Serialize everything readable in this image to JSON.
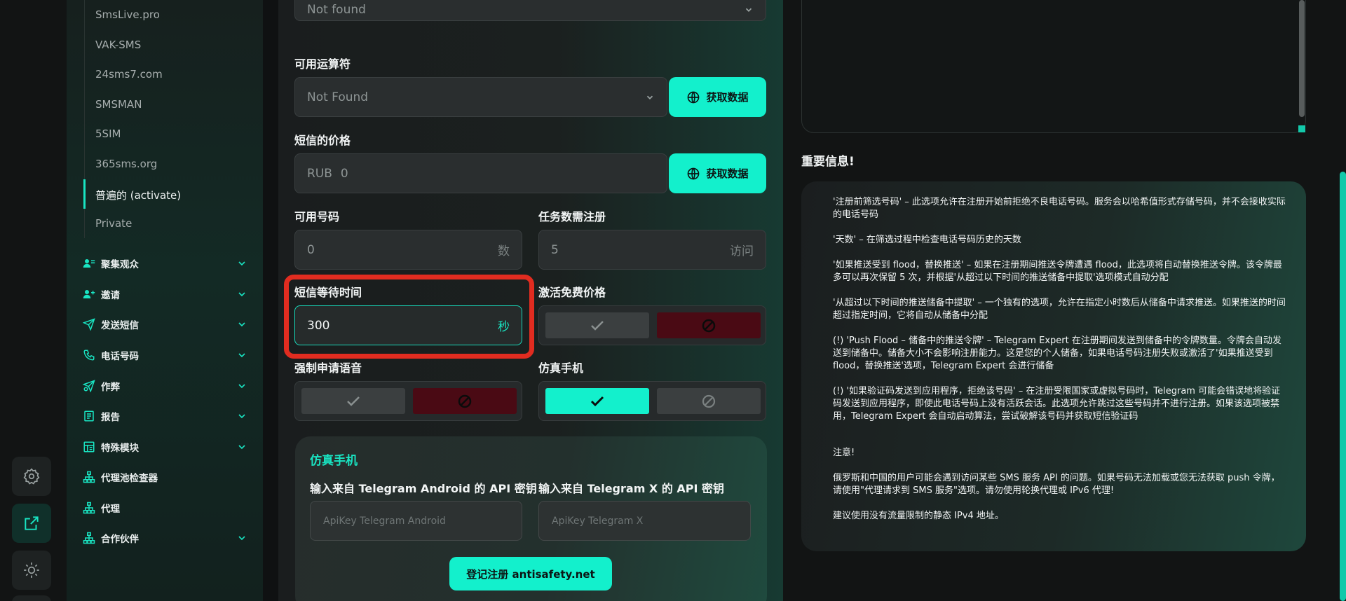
{
  "sidebar": {
    "sub_items": [
      {
        "label": "SmsLive.pro",
        "active": false
      },
      {
        "label": "VAK-SMS",
        "active": false
      },
      {
        "label": "24sms7.com",
        "active": false
      },
      {
        "label": "SMSMAN",
        "active": false
      },
      {
        "label": "5SIM",
        "active": false
      },
      {
        "label": "365sms.org",
        "active": false
      },
      {
        "label": "普遍的 (activate)",
        "active": true
      },
      {
        "label": "Private",
        "active": false
      }
    ],
    "menu": [
      {
        "label": "聚集观众",
        "icon": "users-icon",
        "has_chevron": true
      },
      {
        "label": "邀请",
        "icon": "user-plus-icon",
        "has_chevron": true
      },
      {
        "label": "发送短信",
        "icon": "send-icon",
        "has_chevron": true
      },
      {
        "label": "电话号码",
        "icon": "phone-icon",
        "has_chevron": true
      },
      {
        "label": "作弊",
        "icon": "cheat-icon",
        "has_chevron": true
      },
      {
        "label": "报告",
        "icon": "report-icon",
        "has_chevron": true
      },
      {
        "label": "特殊模块",
        "icon": "module-icon",
        "has_chevron": true
      },
      {
        "label": "代理池检查器",
        "icon": "network-icon",
        "has_chevron": false
      },
      {
        "label": "代理",
        "icon": "network-icon",
        "has_chevron": false
      },
      {
        "label": "合作伙伴",
        "icon": "network-icon",
        "has_chevron": true
      }
    ]
  },
  "rail": {
    "buttons": [
      {
        "icon": "settings-icon",
        "active": false
      },
      {
        "icon": "external-link-icon",
        "active": true
      },
      {
        "icon": "sun-icon",
        "active": false
      }
    ]
  },
  "form": {
    "country_select": {
      "value": "Not found"
    },
    "operator": {
      "label": "可用运算符",
      "value": "Not Found",
      "button": "获取数据"
    },
    "sms_price": {
      "label": "短信的价格",
      "prefix": "RUB",
      "value": "0",
      "button": "获取数据"
    },
    "available_numbers": {
      "label": "可用号码",
      "value": "0",
      "suffix": "数"
    },
    "task_registrations": {
      "label": "任务数需注册",
      "value": "5",
      "suffix": "访问"
    },
    "sms_wait_time": {
      "label": "短信等待时间",
      "value": "300",
      "suffix": "秒"
    },
    "activation_free_price": {
      "label": "激活免费价格",
      "selected": "no"
    },
    "force_voice": {
      "label": "强制申请语音",
      "selected": "no"
    },
    "emulate_phone": {
      "label": "仿真手机",
      "selected": "yes"
    }
  },
  "emulation_card": {
    "title": "仿真手机",
    "android_label": "输入来自 Telegram Android 的 API 密钥",
    "android_placeholder": "ApiKey Telegram Android",
    "x_label": "输入来自 Telegram X 的 API 密钥",
    "x_placeholder": "ApiKey Telegram X",
    "register_button": "登记注册 antisafety.net"
  },
  "info": {
    "title": "重要信息!",
    "paragraphs": [
      "'注册前筛选号码' – 此选项允许在注册开始前拒绝不良电话号码。服务会以哈希值形式存储号码，并不会接收实际的电话号码",
      "'天数' – 在筛选过程中检查电话号码历史的天数",
      "'如果推送受到 flood，替换推送' – 如果在注册期间推送令牌遭遇 flood，此选项将自动替换推送令牌。该令牌最多可以再次保留 5 次，并根据'从超过以下时间的推送储备中提取'选项模式自动分配",
      "'从超过以下时间的推送储备中提取' – 一个独有的选项，允许在指定小时数后从储备中请求推送。如果推送的时间超过指定时间，它将自动从储备中分配",
      "(!) 'Push Flood – 储备中的推送令牌' – Telegram Expert 在注册期间发送到储备中的令牌数量。令牌会自动发送到储备中。储备大小不会影响注册能力。这是您的个人储备，如果电话号码注册失败或激活了'如果推送受到 flood，替换推送'选项，Telegram Expert 会进行储备",
      "(!) '如果验证码发送到应用程序，拒绝该号码' – 在注册受限国家或虚拟号码时，Telegram 可能会错误地将验证码发送到应用程序，即使此电话号码上没有活跃会话。此选项允许跳过这些号码并不进行注册。如果该选项被禁用，Telegram Expert 会自动启动算法，尝试破解该号码并获取短信验证码",
      "注意!",
      "俄罗斯和中国的用户可能会遇到访问某些 SMS 服务 API 的问题。如果号码无法加载或您无法获取 push 令牌，请使用\"代理请求到 SMS 服务\"选项。请勿使用轮换代理或 IPv6 代理!",
      "建议使用没有流量限制的静态 IPv4 地址。"
    ]
  },
  "colors": {
    "accent": "#13f0cc",
    "highlight": "#e12c20",
    "deny": "#4a0a14"
  }
}
